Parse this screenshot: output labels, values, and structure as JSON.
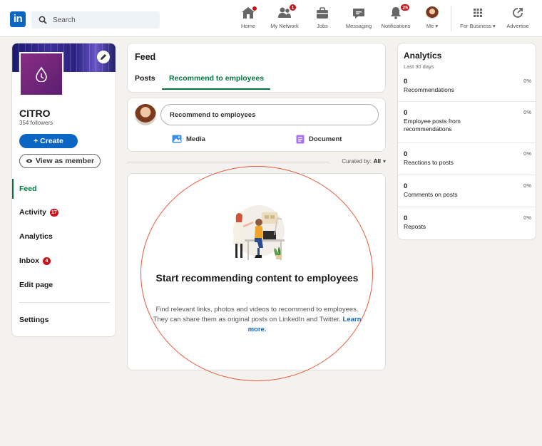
{
  "nav": {
    "logo": "in",
    "search_placeholder": "Search",
    "items": [
      {
        "label": "Home",
        "badge": ""
      },
      {
        "label": "My Network",
        "badge": "1"
      },
      {
        "label": "Jobs",
        "badge": ""
      },
      {
        "label": "Messaging",
        "badge": ""
      },
      {
        "label": "Notifications",
        "badge": "25"
      },
      {
        "label": "Me",
        "badge": ""
      },
      {
        "label": "For Business",
        "badge": ""
      },
      {
        "label": "Advertise",
        "badge": ""
      }
    ]
  },
  "company": {
    "name": "CITRO",
    "followers": "354 followers",
    "create_label": "+ Create",
    "view_label": "View as member"
  },
  "sidebar": {
    "items": [
      {
        "label": "Feed",
        "count": ""
      },
      {
        "label": "Activity",
        "count": "17"
      },
      {
        "label": "Analytics",
        "count": ""
      },
      {
        "label": "Inbox",
        "count": "4"
      },
      {
        "label": "Edit page",
        "count": ""
      },
      {
        "label": "Settings",
        "count": ""
      }
    ]
  },
  "feed": {
    "title": "Feed",
    "tabs": [
      {
        "label": "Posts"
      },
      {
        "label": "Recommend to employees"
      }
    ],
    "composer_placeholder": "Recommend to employees",
    "media_label": "Media",
    "document_label": "Document",
    "curated_prefix": "Curated by:",
    "curated_value": "All"
  },
  "empty_state": {
    "title": "Start recommending content to employees",
    "body": "Find relevant links, photos and videos to recommend to employees. They can share them as original posts on LinkedIn and Twitter.",
    "learn_more": "Learn more."
  },
  "analytics": {
    "title": "Analytics",
    "subtitle": "Last 30 days",
    "metrics": [
      {
        "value": "0",
        "label": "Recommendations",
        "pct": "0%"
      },
      {
        "value": "0",
        "label": "Employee posts from recommendations",
        "pct": "0%"
      },
      {
        "value": "0",
        "label": "Reactions to posts",
        "pct": "0%"
      },
      {
        "value": "0",
        "label": "Comments on posts",
        "pct": "0%"
      },
      {
        "value": "0",
        "label": "Reposts",
        "pct": "0%"
      }
    ]
  },
  "colors": {
    "brand": "#0a66c2",
    "accent_green": "#057642",
    "badge_red": "#cc1016",
    "highlight": "#e65a3c"
  },
  "icons": {
    "nav": [
      "home-icon",
      "my-network-icon",
      "jobs-icon",
      "messaging-icon",
      "notifications-icon",
      "me-avatar",
      "grid-icon",
      "advertise-icon"
    ],
    "composer": [
      "media-icon",
      "document-icon"
    ]
  }
}
